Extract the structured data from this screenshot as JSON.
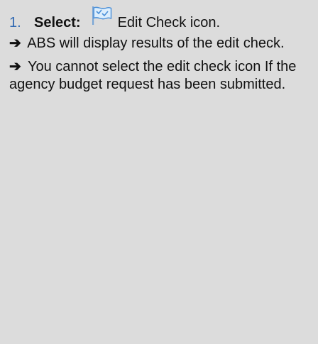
{
  "step": {
    "number": "1.",
    "verb": "Select:",
    "icon": "edit-check-flag-icon",
    "tail": "Edit Check icon."
  },
  "notes": [
    {
      "arrow": "➔",
      "text": "ABS will display results of the edit check."
    },
    {
      "arrow": "➔",
      "text": "You cannot select the edit check icon If the agency budget request has been submitted."
    }
  ],
  "colors": {
    "panel_background": "#dcdcdc",
    "step_number": "#2e67b1",
    "flag_blue": "#4a8fd8"
  }
}
